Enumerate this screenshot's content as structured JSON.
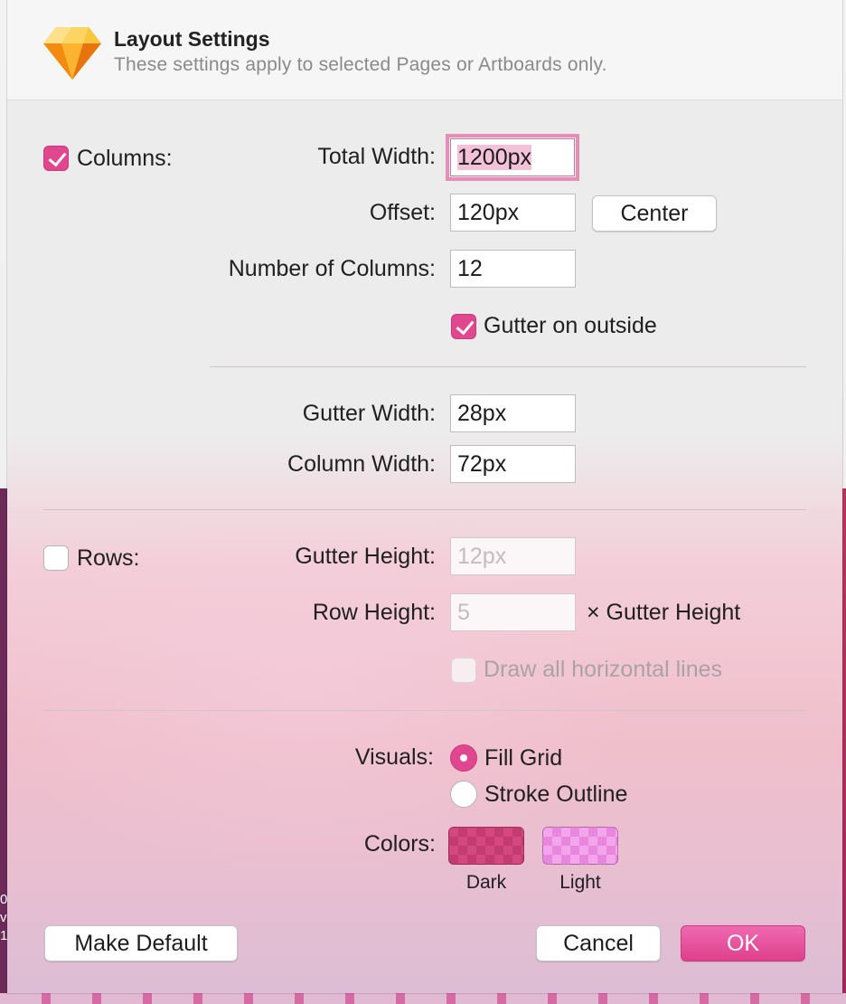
{
  "header": {
    "title": "Layout Settings",
    "subtitle": "These settings apply to selected Pages or Artboards only.",
    "icon": "sketch-diamond-icon"
  },
  "columns": {
    "enabled": true,
    "label": "Columns:",
    "total_width": {
      "label": "Total Width:",
      "value": "1200px"
    },
    "offset": {
      "label": "Offset:",
      "value": "120px"
    },
    "center_button": "Center",
    "number_of_columns": {
      "label": "Number of Columns:",
      "value": "12"
    },
    "gutter_on_outside": {
      "label": "Gutter on outside",
      "checked": true
    },
    "gutter_width": {
      "label": "Gutter Width:",
      "value": "28px"
    },
    "column_width": {
      "label": "Column Width:",
      "value": "72px"
    }
  },
  "rows": {
    "enabled": false,
    "label": "Rows:",
    "gutter_height": {
      "label": "Gutter Height:",
      "placeholder": "12px"
    },
    "row_height": {
      "label": "Row Height:",
      "placeholder": "5",
      "suffix": "× Gutter Height"
    },
    "draw_all_horizontal_lines": {
      "label": "Draw all horizontal lines",
      "checked": false
    }
  },
  "visuals": {
    "label": "Visuals:",
    "options": [
      {
        "label": "Fill Grid",
        "selected": true
      },
      {
        "label": "Stroke Outline",
        "selected": false
      }
    ]
  },
  "colors": {
    "label": "Colors:",
    "dark": {
      "caption": "Dark",
      "color": "#d4487f"
    },
    "light": {
      "caption": "Light",
      "color": "#f4a6ec"
    }
  },
  "footer": {
    "make_default": "Make Default",
    "cancel": "Cancel",
    "ok": "OK"
  },
  "accent_color": "#e0478f",
  "backdrop": {
    "edge_text": "0\nv\n1"
  }
}
